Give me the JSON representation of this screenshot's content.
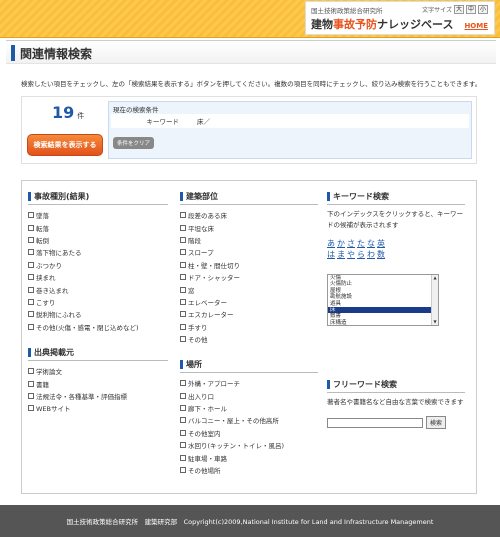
{
  "header": {
    "org": "国土技術政策総合研究所",
    "font_size_label": "文字サイズ",
    "font_buttons": [
      "大",
      "中",
      "小"
    ],
    "site_prefix": "建物",
    "site_highlight": "事故予防",
    "site_suffix": "ナレッジベース",
    "home": "HOME"
  },
  "page": {
    "title": "関連情報検索",
    "intro": "検索したい項目をチェックし、左の「検索結果を表示する」ボタンを押してください。複数の項目を同時にチェックし、絞り込み検索を行うこともできます。"
  },
  "results": {
    "count": "19",
    "unit": "件",
    "show_button": "検索結果を表示する"
  },
  "conditions": {
    "title": "現在の検索条件",
    "keyword_label": "キーワード",
    "keyword_value": "床／",
    "clear_button": "条件をクリア"
  },
  "accident_types": {
    "title": "事故種別(結果)",
    "items": [
      "墜落",
      "転落",
      "転倒",
      "落下物にあたる",
      "ぶつかり",
      "挟まれ",
      "巻き込まれ",
      "こすり",
      "鋭利物にふれる",
      "その他(火傷・感電・閉じ込めなど)"
    ]
  },
  "sources": {
    "title": "出典掲載元",
    "items": [
      "学術論文",
      "書籍",
      "法規法令・各種基準・評価指標",
      "WEBサイト"
    ]
  },
  "building_parts": {
    "title": "建築部位",
    "items": [
      "段差のある床",
      "平坦な床",
      "階段",
      "スロープ",
      "柱・壁・間仕切り",
      "ドア・シャッター",
      "窓",
      "エレベーター",
      "エスカレーター",
      "手すり",
      "その他"
    ]
  },
  "places": {
    "title": "場所",
    "items": [
      "外構・アプローチ",
      "出入り口",
      "廊下・ホール",
      "バルコニー・屋上・その他高所",
      "その他室内",
      "水回り(キッチン・トイレ・風呂)",
      "駐車場・車路",
      "その他場所"
    ]
  },
  "keyword_search": {
    "title": "キーワード検索",
    "desc": "下のインデックスをクリックすると、キーワードの候補が表示されます",
    "index_row1": [
      "あ",
      "か",
      "さ",
      "た",
      "な",
      "英"
    ],
    "index_row2": [
      "は",
      "ま",
      "や",
      "ら",
      "わ",
      "数"
    ],
    "list": [
      "火傷",
      "火傷防止",
      "屋根",
      "勘航施設",
      "遊具",
      "床",
      "敷書",
      "床構造"
    ],
    "selected_index": 5
  },
  "free_word": {
    "title": "フリーワード検索",
    "desc": "著者名や書籍名など自由な言葉で検索できます",
    "input_value": "",
    "button": "検索"
  },
  "footer": {
    "text": "国土技術政策総合研究所　建築研究部　Copyright(c)2009,National Institute for Land and Infrastructure Management"
  },
  "colors": {
    "accent_blue": "#1e5aa8",
    "accent_orange": "#e8541c",
    "header_yellow": "#fbbe38"
  }
}
